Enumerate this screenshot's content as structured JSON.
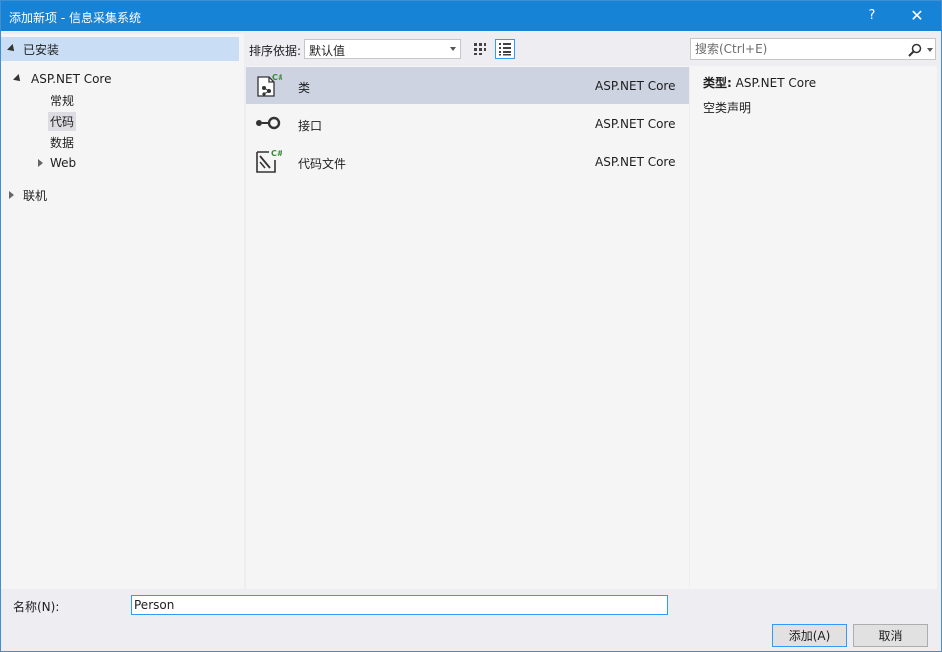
{
  "window": {
    "title": "添加新项 - 信息采集系统",
    "help_label": "?",
    "close_label": "✕"
  },
  "tree": {
    "installed_label": "已安装",
    "items": [
      {
        "label": "ASP.NET Core",
        "expanded": true
      },
      {
        "label": "常规"
      },
      {
        "label": "代码",
        "selected": true
      },
      {
        "label": "数据"
      },
      {
        "label": "Web",
        "expanded": false
      }
    ],
    "online_label": "联机"
  },
  "sort": {
    "label": "排序依据:",
    "value": "默认值"
  },
  "templates": [
    {
      "name": "类",
      "category": "ASP.NET Core",
      "selected": true,
      "icon": "csharp-class-icon"
    },
    {
      "name": "接口",
      "category": "ASP.NET Core",
      "icon": "interface-icon"
    },
    {
      "name": "代码文件",
      "category": "ASP.NET Core",
      "icon": "code-file-icon"
    }
  ],
  "search": {
    "placeholder": "搜索(Ctrl+E)"
  },
  "details": {
    "type_label": "类型:",
    "type_value": "ASP.NET Core",
    "description": "空类声明"
  },
  "form": {
    "name_label": "名称(N):",
    "name_value": "Person"
  },
  "buttons": {
    "add": "添加(A)",
    "cancel": "取消"
  },
  "colors": {
    "titlebar": "#1783d6",
    "selection": "#cdd3e1",
    "focus": "#3399ff"
  }
}
